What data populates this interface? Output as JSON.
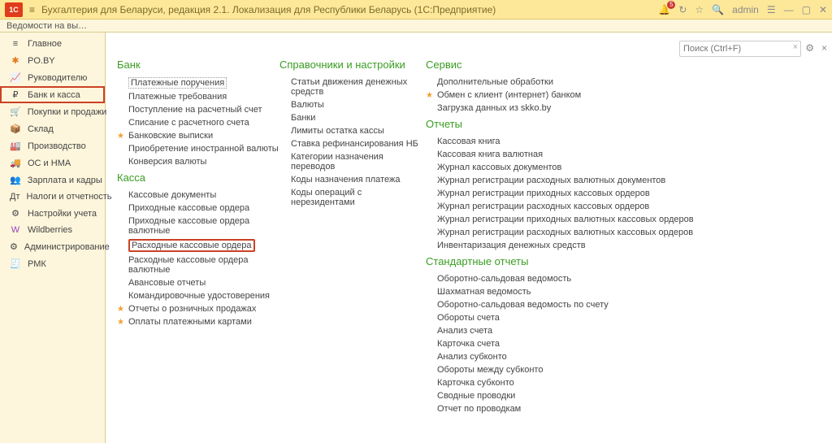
{
  "topbar": {
    "logo": "1C",
    "title": "Бухгалтерия для Беларуси, редакция 2.1. Локализация для Республики Беларусь   (1С:Предприятие)",
    "bell_count": "5",
    "user": "admin"
  },
  "tabbar": {
    "tab1": "Ведомости на выплату зарпл"
  },
  "sidebar": [
    {
      "icon": "≡",
      "label": "Главное",
      "cls": "dark"
    },
    {
      "icon": "✱",
      "label": "PO.BY",
      "cls": "orange"
    },
    {
      "icon": "📈",
      "label": "Руководителю",
      "cls": "dark"
    },
    {
      "icon": "₽",
      "label": "Банк и касса",
      "cls": "dark",
      "selected": true
    },
    {
      "icon": "🛒",
      "label": "Покупки и продажи",
      "cls": "dark"
    },
    {
      "icon": "📦",
      "label": "Склад",
      "cls": "dark"
    },
    {
      "icon": "🏭",
      "label": "Производство",
      "cls": "dark"
    },
    {
      "icon": "🚚",
      "label": "ОС и НМА",
      "cls": "dark"
    },
    {
      "icon": "👥",
      "label": "Зарплата и кадры",
      "cls": "dark"
    },
    {
      "icon": "Дт",
      "label": "Налоги и отчетность",
      "cls": "dark"
    },
    {
      "icon": "⚙",
      "label": "Настройки учета",
      "cls": "dark"
    },
    {
      "icon": "W",
      "label": "Wildberries",
      "cls": "purple"
    },
    {
      "icon": "⚙",
      "label": "Администрирование",
      "cls": "dark"
    },
    {
      "icon": "🧾",
      "label": "РМК",
      "cls": "dark"
    }
  ],
  "search": {
    "placeholder": "Поиск (Ctrl+F)"
  },
  "sections": {
    "col1": [
      {
        "title": "Банк",
        "items": [
          {
            "text": "Платежные поручения",
            "boxed": true
          },
          {
            "text": "Платежные требования"
          },
          {
            "text": "Поступление на расчетный счет"
          },
          {
            "text": "Списание с расчетного счета"
          },
          {
            "text": "Банковские выписки",
            "star": true
          },
          {
            "text": "Приобретение иностранной валюты"
          },
          {
            "text": "Конверсия валюты"
          }
        ]
      },
      {
        "title": "Касса",
        "items": [
          {
            "text": "Кассовые документы"
          },
          {
            "text": "Приходные кассовые ордера"
          },
          {
            "text": "Приходные кассовые ордера валютные"
          },
          {
            "text": "Расходные кассовые ордера",
            "redbox": true
          },
          {
            "text": "Расходные кассовые ордера валютные"
          },
          {
            "text": "Авансовые отчеты"
          },
          {
            "text": "Командировочные удостоверения"
          },
          {
            "text": "Отчеты о розничных продажах",
            "star": true
          },
          {
            "text": "Оплаты платежными картами",
            "star": true
          }
        ]
      }
    ],
    "col2": [
      {
        "title": "Справочники и настройки",
        "items": [
          {
            "text": "Статьи движения денежных средств"
          },
          {
            "text": "Валюты"
          },
          {
            "text": "Банки"
          },
          {
            "text": "Лимиты остатка кассы"
          },
          {
            "text": "Ставка рефинансирования НБ"
          },
          {
            "text": "Категории назначения переводов"
          },
          {
            "text": "Коды назначения платежа"
          },
          {
            "text": "Коды операций с нерезидентами"
          }
        ]
      }
    ],
    "col3": [
      {
        "title": "Сервис",
        "items": [
          {
            "text": "Дополнительные обработки"
          },
          {
            "text": "Обмен с клиент (интернет) банком",
            "star": true
          },
          {
            "text": "Загрузка данных из skko.by"
          }
        ]
      },
      {
        "title": "Отчеты",
        "items": [
          {
            "text": "Кассовая книга"
          },
          {
            "text": "Кассовая книга валютная"
          },
          {
            "text": "Журнал кассовых документов"
          },
          {
            "text": "Журнал регистрации расходных валютных документов"
          },
          {
            "text": "Журнал регистрации приходных кассовых ордеров"
          },
          {
            "text": "Журнал регистрации расходных кассовых ордеров"
          },
          {
            "text": "Журнал регистрации приходных валютных кассовых ордеров"
          },
          {
            "text": "Журнал регистрации расходных валютных кассовых ордеров"
          },
          {
            "text": "Инвентаризация денежных средств"
          }
        ]
      },
      {
        "title": "Стандартные отчеты",
        "items": [
          {
            "text": "Оборотно-сальдовая ведомость"
          },
          {
            "text": "Шахматная ведомость"
          },
          {
            "text": "Оборотно-сальдовая ведомость по счету"
          },
          {
            "text": "Обороты счета"
          },
          {
            "text": "Анализ счета"
          },
          {
            "text": "Карточка счета"
          },
          {
            "text": "Анализ субконто"
          },
          {
            "text": "Обороты между субконто"
          },
          {
            "text": "Карточка субконто"
          },
          {
            "text": "Сводные проводки"
          },
          {
            "text": "Отчет по проводкам"
          }
        ]
      }
    ]
  }
}
